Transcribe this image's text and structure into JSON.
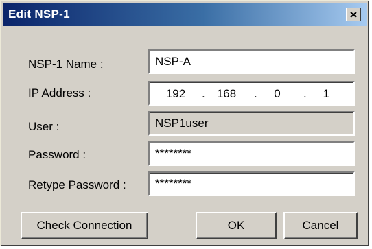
{
  "title": "Edit NSP-1",
  "fields": {
    "name_label": "NSP-1 Name :",
    "name_value": "NSP-A",
    "ip_label": "IP Address :",
    "ip_octets": [
      "192",
      "168",
      "0",
      "1"
    ],
    "ip_sep": ".",
    "user_label": "User :",
    "user_value": "NSP1user",
    "password_label": "Password :",
    "password_value": "********",
    "retype_label": "Retype Password :",
    "retype_value": "********"
  },
  "buttons": {
    "check": "Check Connection",
    "ok": "OK",
    "cancel": "Cancel"
  },
  "icons": {
    "close": "close-icon"
  }
}
